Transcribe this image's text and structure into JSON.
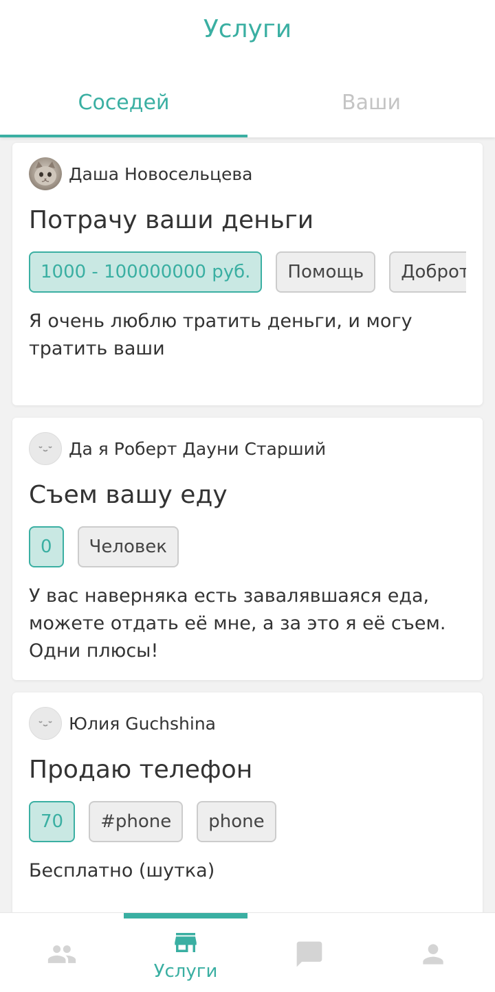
{
  "header": {
    "title": "Услуги",
    "tabs": [
      {
        "label": "Соседей",
        "active": true
      },
      {
        "label": "Ваши",
        "active": false
      }
    ]
  },
  "colors": {
    "accent": "#3aafa2",
    "tag_price_bg": "#c9e8e3",
    "tag_bg": "#eeeeee",
    "inactive_icon": "#d4d4d4"
  },
  "cards": [
    {
      "author": "Даша Новосельцева",
      "avatar": "cat-photo",
      "title": "Потрачу ваши деньги",
      "price": "1000 - 100000000 руб.",
      "tags": [
        "Помощь",
        "Доброта"
      ],
      "description": "Я очень люблю тратить деньги, и могу тратить ваши"
    },
    {
      "author": "Да я Роберт Дауни Старший",
      "avatar": "default-face",
      "title": "Съем вашу еду",
      "price": "0",
      "tags": [
        "Человек"
      ],
      "description": "У вас наверняка есть завалявшаяся еда, можете отдать её мне, а за это я её съем. Одни плюсы!"
    },
    {
      "author": "Юлия Guchshina",
      "avatar": "default-face",
      "title": "Продаю телефон",
      "price": "70",
      "tags": [
        "#phone",
        "phone"
      ],
      "description": "Бесплатно (шутка)"
    }
  ],
  "bottom_nav": {
    "items": [
      {
        "icon": "people-icon",
        "label": "",
        "active": false
      },
      {
        "icon": "store-icon",
        "label": "Услуги",
        "active": true
      },
      {
        "icon": "chat-icon",
        "label": "",
        "active": false
      },
      {
        "icon": "person-icon",
        "label": "",
        "active": false
      }
    ]
  }
}
